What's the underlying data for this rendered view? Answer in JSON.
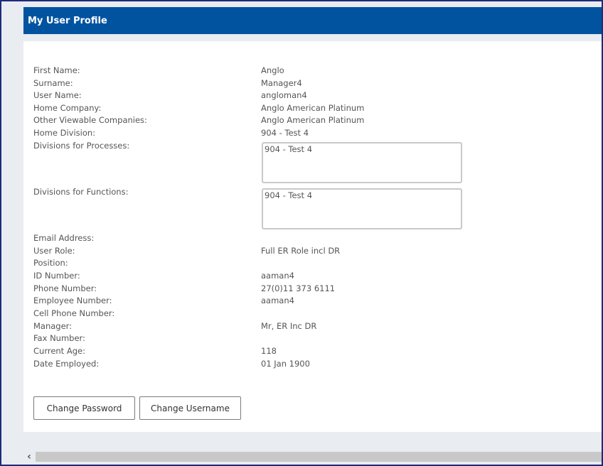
{
  "header": {
    "title": "My User Profile"
  },
  "profile": {
    "fields": [
      {
        "label": "First Name:",
        "value": "Anglo"
      },
      {
        "label": "Surname:",
        "value": "Manager4"
      },
      {
        "label": "User Name:",
        "value": "angloman4"
      },
      {
        "label": "Home Company:",
        "value": "Anglo American Platinum"
      },
      {
        "label": "Other Viewable Companies:",
        "value": "Anglo American Platinum"
      },
      {
        "label": "Home Division:",
        "value": "904 - Test 4"
      },
      {
        "label": "Divisions for Processes:",
        "value": "904 - Test 4"
      },
      {
        "label": "Divisions for Functions:",
        "value": "904 - Test 4"
      },
      {
        "label": "Email Address:",
        "value": ""
      },
      {
        "label": "User Role:",
        "value": "Full ER Role incl DR"
      },
      {
        "label": "Position:",
        "value": ""
      },
      {
        "label": "ID Number:",
        "value": "aaman4"
      },
      {
        "label": "Phone Number:",
        "value": "27(0)11 373 6111"
      },
      {
        "label": "Employee Number:",
        "value": "aaman4"
      },
      {
        "label": "Cell Phone Number:",
        "value": ""
      },
      {
        "label": "Manager:",
        "value": "Mr, ER Inc DR"
      },
      {
        "label": "Fax Number:",
        "value": ""
      },
      {
        "label": "Current Age:",
        "value": "118"
      },
      {
        "label": "Date Employed:",
        "value": "01 Jan 1900"
      }
    ]
  },
  "buttons": {
    "change_password": "Change Password",
    "change_username": "Change Username"
  },
  "icons": {
    "scroll_left": "chevron-left-icon"
  }
}
